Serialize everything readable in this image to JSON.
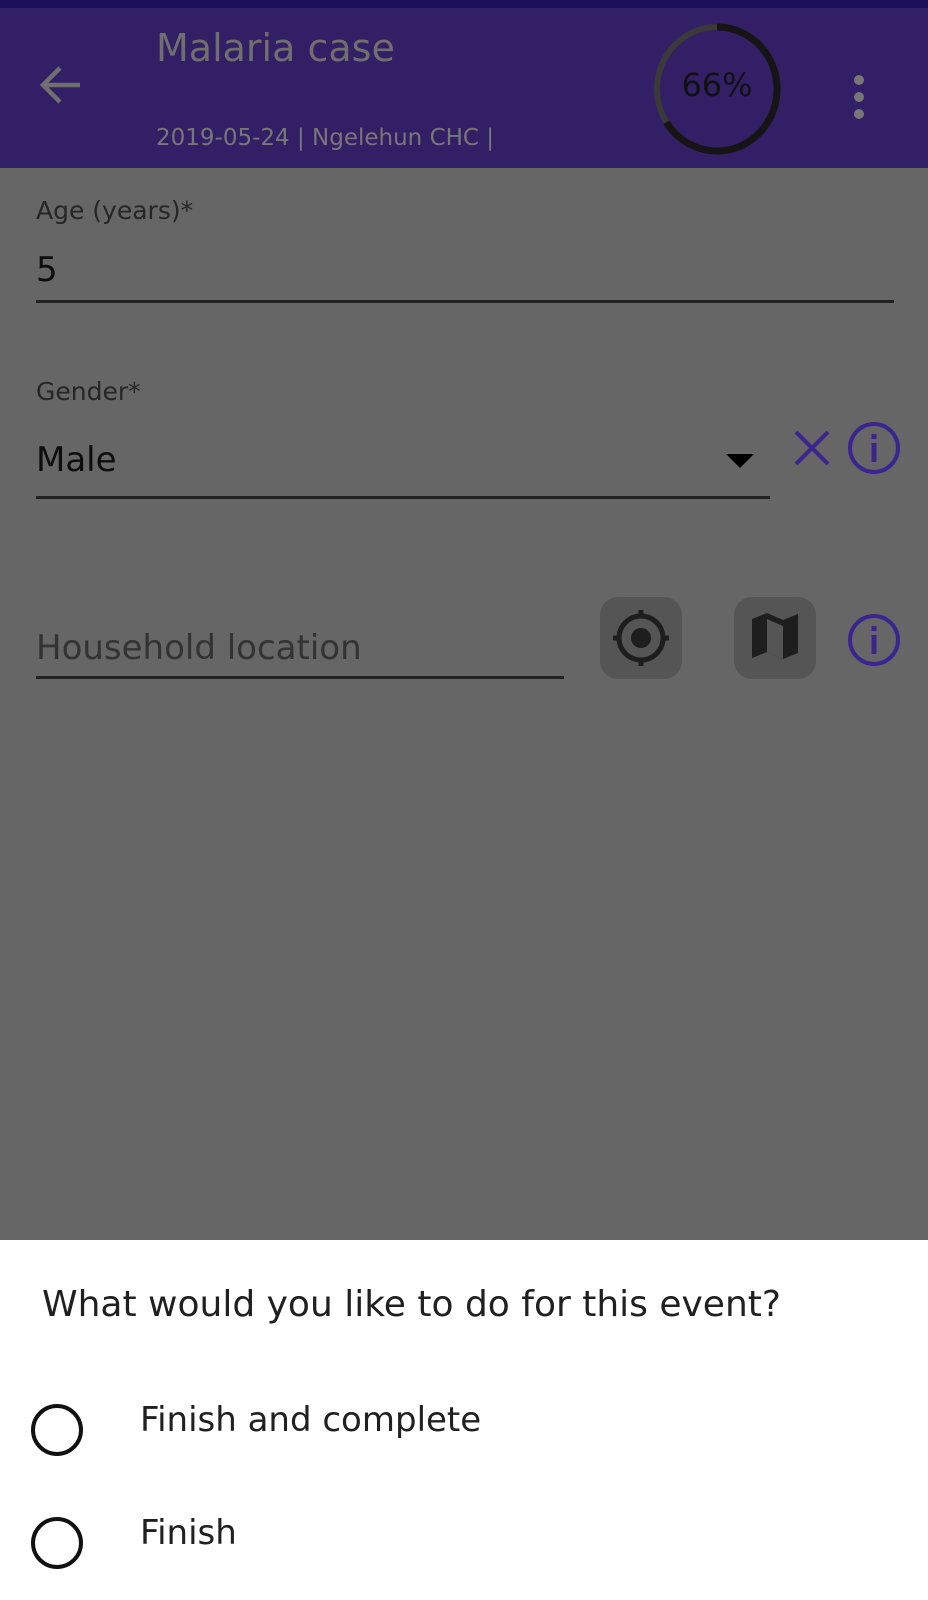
{
  "header": {
    "title": "Malaria case",
    "subtitle": "2019-05-24 | Ngelehun CHC |",
    "progress_percent": 66,
    "progress_label": "66%"
  },
  "form": {
    "age": {
      "label": "Age (years)*",
      "value": "5"
    },
    "gender": {
      "label": "Gender*",
      "value": "Male"
    },
    "household": {
      "placeholder": "Household location"
    }
  },
  "sheet": {
    "question": "What would you like to do for this event?",
    "options": [
      {
        "label": "Finish and complete",
        "selected": false
      },
      {
        "label": "Finish",
        "selected": false
      }
    ]
  },
  "colors": {
    "header": "#331f66",
    "accent": "#3a2590",
    "overlay": "#666666"
  }
}
